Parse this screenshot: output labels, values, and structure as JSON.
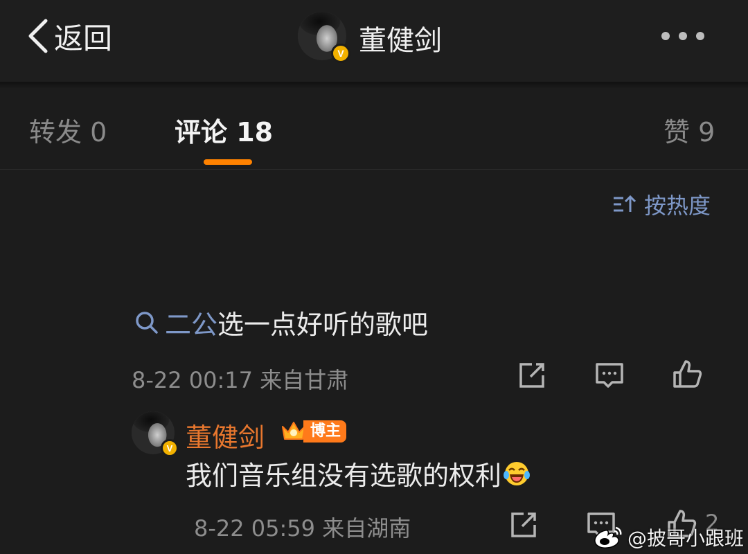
{
  "header": {
    "back_label": "返回",
    "title": "董健剑",
    "verified_badge": "V"
  },
  "tabs": {
    "repost": "转发 0",
    "comments": "评论 18",
    "likes": "赞 9"
  },
  "sort": {
    "label": "按热度"
  },
  "comment": {
    "link_text": "二公",
    "text": "选一点好听的歌吧",
    "meta": "8-22 00:17 来自甘肃"
  },
  "reply": {
    "author": "董健剑",
    "badge_label": "博主",
    "verified_badge": "V",
    "text": "我们音乐组没有选歌的权利",
    "meta": "8-22 05:59 来自湖南",
    "like_count": "2"
  },
  "watermark": {
    "text": "@披哥小跟班"
  },
  "colors": {
    "background": "#1c1c1c",
    "accent_orange": "#ff8200",
    "link_blue": "#7e98c8",
    "author_orange": "#e8772e"
  }
}
